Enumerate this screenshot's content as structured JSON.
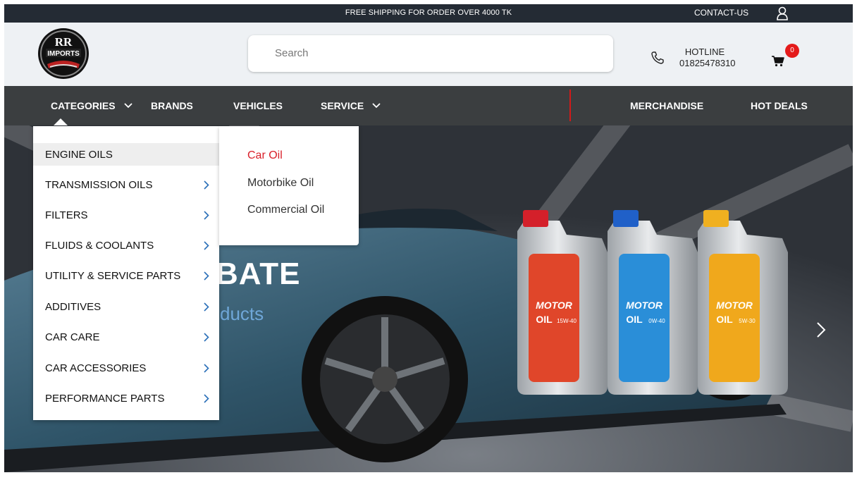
{
  "topbar": {
    "shipping_text": "FREE SHIPPING FOR ORDER OVER 4000 TK",
    "contact_label": "CONTACT-US",
    "user_icon": "user-icon"
  },
  "header": {
    "logo_text_top": "RR",
    "logo_text_bottom": "IMPORTS",
    "search_placeholder": "Search",
    "hotline_label": "HOTLINE",
    "hotline_number": "01825478310",
    "cart_count": "0",
    "phone_icon": "phone-icon",
    "cart_icon": "cart-icon"
  },
  "nav": {
    "categories": "CATEGORIES",
    "brands": "BRANDS",
    "vehicles": "VEHICLES",
    "service": "SERVICE",
    "merchandise": "MERCHANDISE",
    "hot_deals": "HOT DEALS"
  },
  "categories_menu": [
    {
      "label": "ENGINE OILS",
      "active": true
    },
    {
      "label": "TRANSMISSION OILS"
    },
    {
      "label": "FILTERS"
    },
    {
      "label": "FLUIDS & COOLANTS"
    },
    {
      "label": "UTILITY & SERVICE PARTS"
    },
    {
      "label": "ADDITIVES"
    },
    {
      "label": "CAR CARE"
    },
    {
      "label": "CAR ACCESSORIES"
    },
    {
      "label": "PERFORMANCE PARTS"
    }
  ],
  "submenu": [
    {
      "label": "Car Oil",
      "active": true
    },
    {
      "label": "Motorbike Oil"
    },
    {
      "label": "Commercial Oil"
    }
  ],
  "hero": {
    "headline_fragment": "BATE",
    "subline_fragment": "ducts",
    "jug_brand_top": "MOTOR",
    "jug_brand_bottom": "OIL",
    "jugs": [
      {
        "grade": "15W-40",
        "cap_color": "#d4202a",
        "label_color": "#e0462a"
      },
      {
        "grade": "0W-40",
        "cap_color": "#2060c8",
        "label_color": "#2a8ed8"
      },
      {
        "grade": "5W-30",
        "cap_color": "#f0b020",
        "label_color": "#f0a81c"
      }
    ]
  },
  "colors": {
    "topbar_bg": "#242b34",
    "nav_bg": "#3b3e40",
    "accent_red": "#d9202a"
  }
}
